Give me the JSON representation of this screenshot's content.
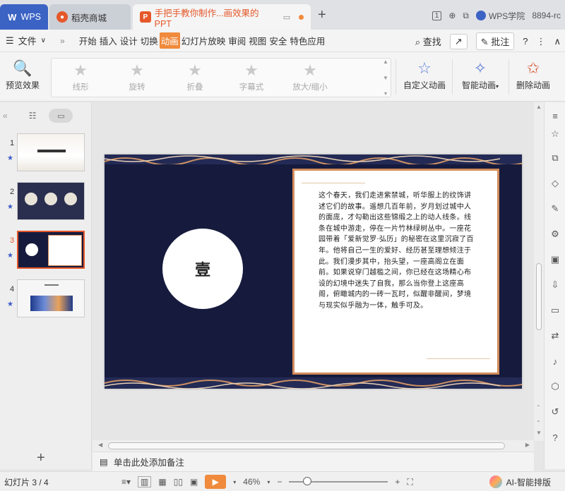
{
  "titlebar": {
    "tabs": [
      {
        "label": "WPS"
      },
      {
        "label": "稻壳商城"
      },
      {
        "label": "手把手教你制作...画效果的PPT"
      }
    ],
    "page_badge": "1",
    "academy": "WPS学院",
    "account": "8894-rc"
  },
  "menubar": {
    "file": "文件",
    "items": [
      "开始",
      "插入",
      "设计",
      "切换",
      "动画",
      "幻灯片放映",
      "审阅",
      "视图",
      "安全",
      "特色应用"
    ],
    "active_item": "动画",
    "search": "查找",
    "comment": "批注"
  },
  "ribbon": {
    "preview": "预览效果",
    "gallery": [
      "线形",
      "旋转",
      "折叠",
      "字幕式",
      "放大/缩小"
    ],
    "custom": "自定义动画",
    "smart": "智能动画",
    "delete": "删除动画"
  },
  "slides": [
    {
      "num": "1"
    },
    {
      "num": "2"
    },
    {
      "num": "3"
    },
    {
      "num": "4"
    }
  ],
  "current_slide": {
    "circle_text": "壹",
    "body": "这个春天，我们走进紫禁城，听华服上的纹饰讲述它们的故事。遥想几百年前，岁月划过城中人的面庞，才勾勒出这些锦缎之上的动人线条。线条在城中游走，停在一片竹林绿树丛中。一座花园带着「爱新觉罗·弘历」的秘密在这里沉寂了百年。他将自己一生的爱好、经历甚至理想倾注于此。我们漫步其中，抬头望，一座高阁立在面前。如果说穿门越槛之间，你已经在这场精心布设的幻境中迷失了自我，那么当你登上这座高阁，俯瞰城内的一砖一瓦时，似醒非醒间，梦境与现实似乎融为一体，触手可及。"
  },
  "notes_placeholder": "单击此处添加备注",
  "status": {
    "slide_counter": "幻灯片 3 / 4",
    "zoom": "46%",
    "zoom_fraction": 0.18,
    "ai": "AI-智能排版"
  }
}
